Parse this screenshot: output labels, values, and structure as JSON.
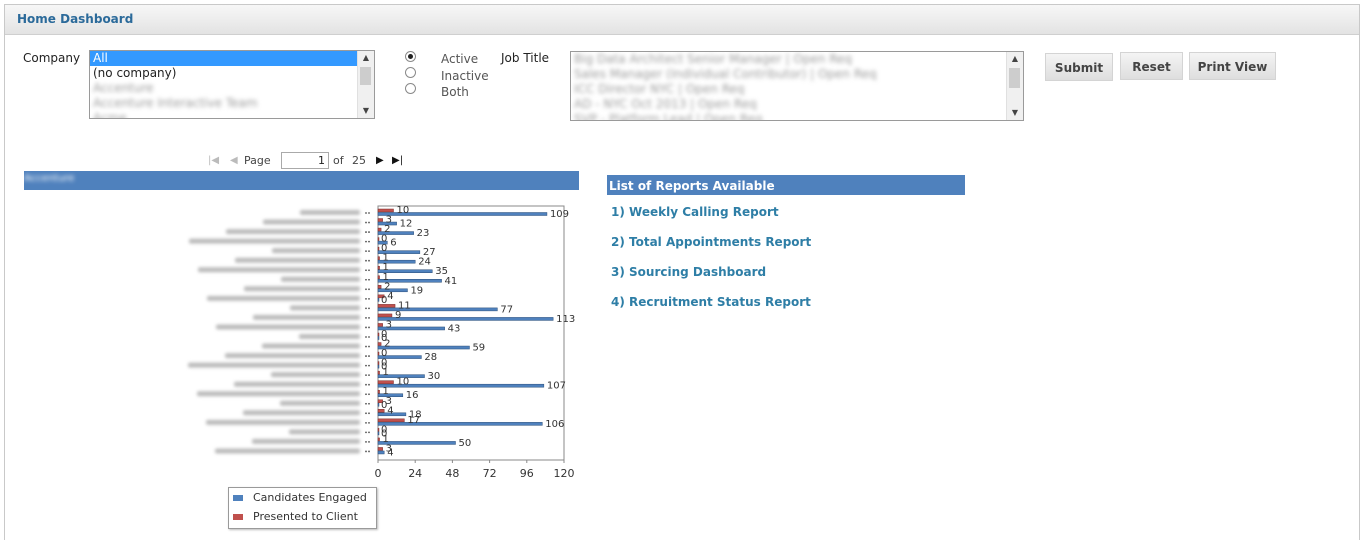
{
  "header": {
    "title": "Home Dashboard"
  },
  "filters": {
    "company_label": "Company",
    "company_options": [
      {
        "label": "All",
        "selected": true,
        "blurred": false
      },
      {
        "label": "(no company)",
        "selected": false,
        "blurred": false
      },
      {
        "label": "Accenture",
        "selected": false,
        "blurred": true
      },
      {
        "label": "Accenture Interactive Team",
        "selected": false,
        "blurred": true
      },
      {
        "label": "Acme",
        "selected": false,
        "blurred": true
      }
    ],
    "status_options": [
      {
        "label": "Active",
        "checked": true
      },
      {
        "label": "Inactive",
        "checked": false
      },
      {
        "label": "Both",
        "checked": false
      }
    ],
    "job_title_label": "Job Title",
    "job_title_options": [
      "Big Data Architect Senior Manager | Open Req",
      "Sales Manager (Individual Contributor) | Open Req",
      "ICC Director NYC | Open Req",
      "AD - NYC Oct 2013 | Open Req",
      "SVP - Platform Lead | Open Req"
    ]
  },
  "buttons": {
    "submit": "Submit",
    "reset": "Reset",
    "print": "Print View"
  },
  "pager": {
    "page_label": "Page",
    "current_page": "1",
    "of_label": "of",
    "total_pages": "25"
  },
  "chart_header": "Accenture",
  "chart_data": {
    "type": "bar",
    "orientation": "horizontal",
    "xlim": [
      0,
      120
    ],
    "xticks": [
      "0",
      "24",
      "48",
      "72",
      "96",
      "120"
    ],
    "series": [
      {
        "name": "Candidates Engaged",
        "color": "#4f81bd",
        "values": [
          109,
          12,
          23,
          6,
          27,
          24,
          35,
          41,
          19,
          0,
          77,
          113,
          43,
          0,
          59,
          28,
          0,
          30,
          107,
          16,
          0,
          18,
          106,
          0,
          50,
          4
        ]
      },
      {
        "name": "Presented to Client",
        "color": "#c0504d",
        "values": [
          10,
          3,
          2,
          0,
          0,
          1,
          1,
          1,
          2,
          4,
          11,
          9,
          3,
          0,
          2,
          0,
          0,
          1,
          10,
          1,
          3,
          4,
          17,
          0,
          1,
          3
        ]
      }
    ]
  },
  "reports": {
    "title": "List of Reports Available",
    "items": [
      "1) Weekly Calling Report",
      "2) Total Appointments Report",
      "3) Sourcing Dashboard",
      "4) Recruitment Status Report"
    ]
  }
}
